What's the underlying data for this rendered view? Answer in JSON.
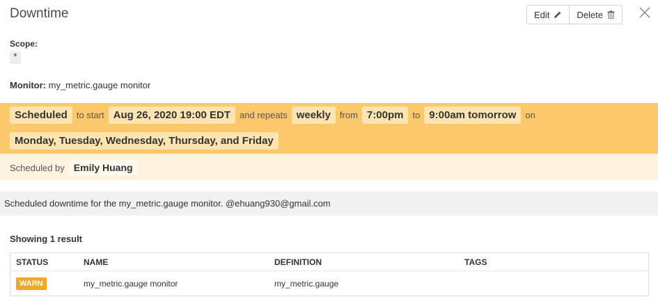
{
  "header": {
    "title": "Downtime",
    "edit_label": "Edit",
    "delete_label": "Delete"
  },
  "scope": {
    "label": "Scope:",
    "value": "*"
  },
  "monitor": {
    "label": "Monitor:",
    "value": "my_metric.gauge monitor"
  },
  "schedule": {
    "status": "Scheduled",
    "to_start_text": "to start",
    "start": "Aug 26, 2020 19:00 EDT",
    "repeats_text": "and repeats",
    "frequency": "weekly",
    "from_text": "from",
    "from_time": "7:00pm",
    "to_text": "to",
    "to_time": "9:00am tomorrow",
    "on_text": "on",
    "days": "Monday, Tuesday, Wednesday, Thursday, and Friday",
    "scheduled_by_label": "Scheduled by",
    "scheduled_by": "Emily Huang"
  },
  "message": "Scheduled downtime for the my_metric.gauge monitor. @ehuang930@gmail.com",
  "results": {
    "count_text": "Showing 1 result",
    "columns": [
      "STATUS",
      "NAME",
      "DEFINITION",
      "TAGS"
    ],
    "rows": [
      {
        "status": "WARN",
        "name": "my_metric.gauge monitor",
        "definition": "my_metric.gauge",
        "tags": ""
      }
    ]
  },
  "colors": {
    "schedule_band": "#fdc86c",
    "scheduled_by_band": "#fef3de",
    "warn_badge": "#f5a623"
  },
  "icons": {
    "edit": "pencil-icon",
    "delete": "trash-icon",
    "close": "close-icon"
  }
}
